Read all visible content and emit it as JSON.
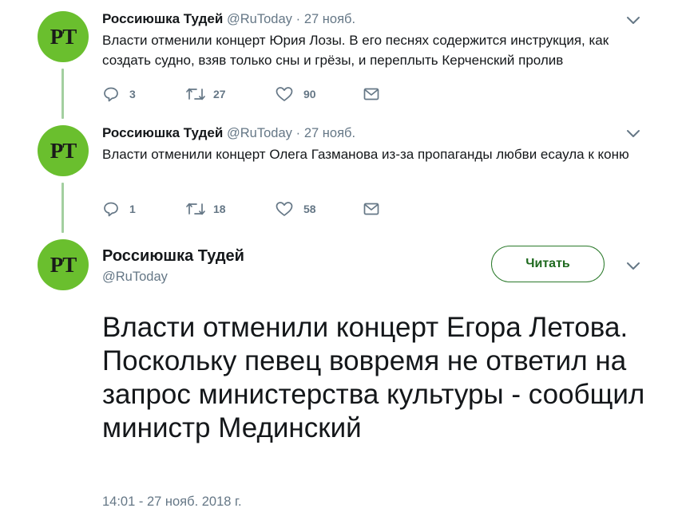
{
  "tweets": [
    {
      "avatar_text": "PT",
      "name": "Россиюшка Тудей",
      "handle": "@RuToday",
      "separator": "·",
      "date": "27 нояб.",
      "text": "Власти отменили концерт Юрия Лозы. В его песнях содержится инструкция, как создать судно, взяв только сны и грёзы, и переплыть Керченский пролив",
      "replies": "3",
      "retweets": "27",
      "likes": "90"
    },
    {
      "avatar_text": "PT",
      "name": "Россиюшка Тудей",
      "handle": "@RuToday",
      "separator": "·",
      "date": "27 нояб.",
      "text": "Власти отменили концерт Олега Газманова из-за пропаганды любви есаула к коню",
      "replies": "1",
      "retweets": "18",
      "likes": "58"
    }
  ],
  "main_tweet": {
    "avatar_text": "PT",
    "name": "Россиюшка Тудей",
    "handle": "@RuToday",
    "follow_label": "Читать",
    "text": "Власти отменили концерт Егора Летова. Поскольку певец вовремя не ответил на запрос министерства культуры - сообщил министр Мединский",
    "timestamp": "14:01 - 27 нояб. 2018 г."
  },
  "colors": {
    "avatar_bg": "#6abf2e",
    "thread_line": "#a3cfa0",
    "follow_accent": "#2b7a2b",
    "muted_text": "#657786"
  },
  "icons": [
    "reply-icon",
    "retweet-icon",
    "like-icon",
    "message-icon",
    "chevron-down-icon"
  ]
}
